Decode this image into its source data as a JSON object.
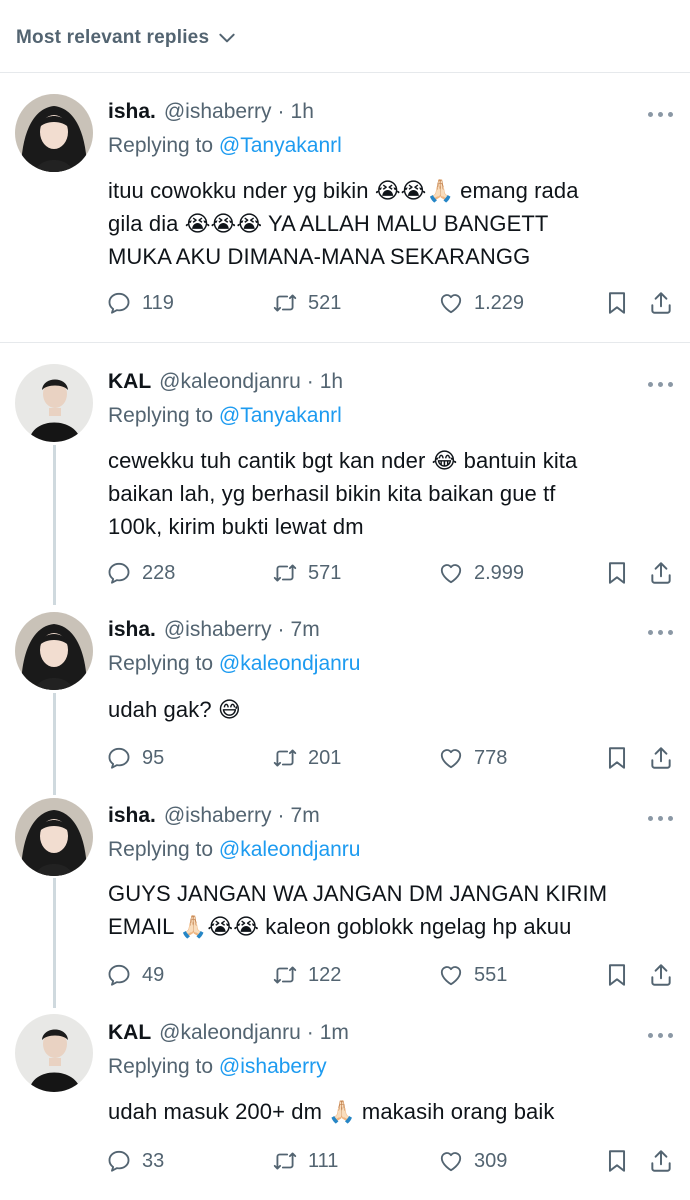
{
  "header": {
    "sort_label": "Most relevant replies"
  },
  "tweets": [
    {
      "name": "isha.",
      "handle": "@ishaberry",
      "time": "1h",
      "reply_prefix": "Replying to",
      "reply_to": "@Tanyakanrl",
      "lines": [
        "ituu cowokku nder yg bikin 😭😭🙏🏻 emang rada",
        "gila dia 😭😭😭 YA ALLAH MALU BANGETT",
        "MUKA AKU DIMANA-MANA SEKARANGG"
      ],
      "replies": "119",
      "retweets": "521",
      "likes": "1.229"
    },
    {
      "name": "KAL",
      "handle": "@kaleondjanru",
      "time": "1h",
      "reply_prefix": "Replying to",
      "reply_to": "@Tanyakanrl",
      "lines": [
        "cewekku tuh cantik bgt kan nder 😂 bantuin kita",
        "baikan lah, yg berhasil bikin kita baikan gue tf",
        "100k, kirim bukti lewat dm"
      ],
      "replies": "228",
      "retweets": "571",
      "likes": "2.999"
    },
    {
      "name": "isha.",
      "handle": "@ishaberry",
      "time": "7m",
      "reply_prefix": "Replying to",
      "reply_to": "@kaleondjanru",
      "lines": [
        "udah gak? 😅"
      ],
      "replies": "95",
      "retweets": "201",
      "likes": "778"
    },
    {
      "name": "isha.",
      "handle": "@ishaberry",
      "time": "7m",
      "reply_prefix": "Replying to",
      "reply_to": "@kaleondjanru",
      "lines": [
        "GUYS JANGAN WA JANGAN DM JANGAN KIRIM",
        "EMAIL 🙏🏻😭😭 kaleon goblokk ngelag hp akuu"
      ],
      "replies": "49",
      "retweets": "122",
      "likes": "551"
    },
    {
      "name": "KAL",
      "handle": "@kaleondjanru",
      "time": "1m",
      "reply_prefix": "Replying to",
      "reply_to": "@ishaberry",
      "lines": [
        "udah masuk 200+ dm 🙏🏻 makasih orang baik"
      ],
      "replies": "33",
      "retweets": "111",
      "likes": "309"
    }
  ],
  "colors": {
    "link": "#1d9bf0",
    "secondary": "#536471",
    "primary_text": "#0f1419",
    "divider": "#e6e9ec",
    "thread_line": "#cfd9de"
  },
  "icons": [
    "chevron-down-icon",
    "more-icon",
    "reply-icon",
    "retweet-icon",
    "like-icon",
    "bookmark-icon",
    "share-icon"
  ]
}
